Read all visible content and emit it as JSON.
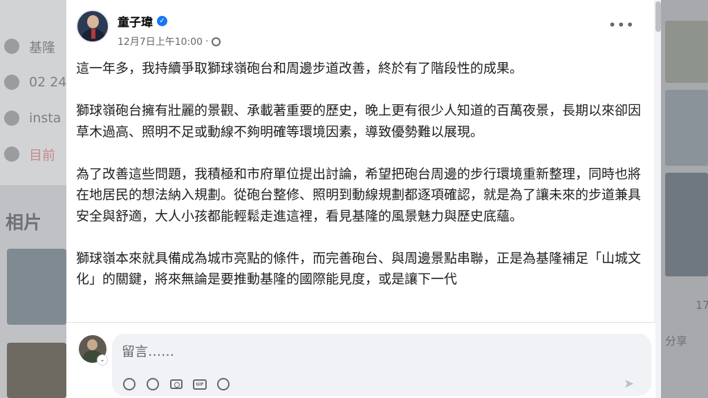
{
  "background": {
    "left_rows": [
      {
        "text": "基隆",
        "icon": "location-icon"
      },
      {
        "text": "02 24",
        "icon": "phone-icon"
      },
      {
        "text": "insta",
        "icon": "link-icon"
      },
      {
        "text": "目前",
        "icon": "clock-icon"
      }
    ],
    "photos_title": "相片",
    "right_meta": {
      "count": "17",
      "share": "分享"
    }
  },
  "post": {
    "author": "童子瑋",
    "verified_mark": "✓",
    "time": "12月7日上午10:00",
    "separator": "·",
    "more": "•••",
    "paragraphs": [
      "這一年多，我持續爭取獅球嶺砲台和周邊步道改善，終於有了階段性的成果。",
      "獅球嶺砲台擁有壯麗的景觀、承載著重要的歷史，晚上更有很少人知道的百萬夜景，長期以來卻因草木過高、照明不足或動線不夠明確等環境因素，導致優勢難以展現。",
      "為了改善這些問題，我積極和市府單位提出討論，希望把砲台周邊的步行環境重新整理，同時也將在地居民的想法納入規劃。從砲台整修、照明到動線規劃都逐項確認，就是為了讓未來的步道兼具安全與舒適，大人小孩都能輕鬆走進這裡，看見基隆的風景魅力與歷史底蘊。",
      "獅球嶺本來就具備成為城市亮點的條件，而完善砲台、與周邊景點串聯，正是為基隆補足「山城文化」的關鍵，將來無論是要推動基隆的國際能見度，或是讓下一代"
    ]
  },
  "composer": {
    "placeholder": "留言……",
    "chevron": "⌄",
    "tools": [
      "avatar-sticker-icon",
      "emoji-icon",
      "camera-icon",
      "gif-icon",
      "sticker-icon"
    ],
    "gif_label": "GIF",
    "send": "➤"
  }
}
